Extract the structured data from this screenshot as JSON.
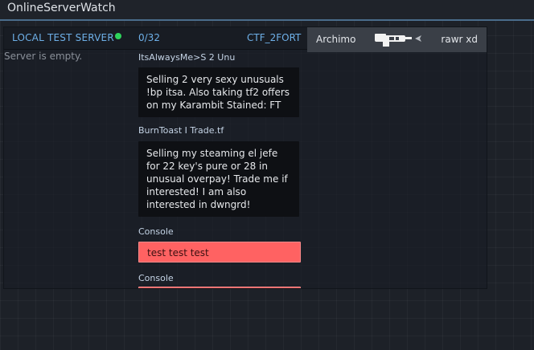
{
  "app": {
    "title": "OnlineServerWatch"
  },
  "server": {
    "name": "LOCAL TEST SERVER",
    "status": "online",
    "status_color": "#2ed35b",
    "players": "0/32",
    "map": "CTF_2FORT",
    "empty_message": "Server is empty."
  },
  "killfeed": {
    "killer": "Archimo",
    "weapon_icon": "shotgun-icon",
    "victim": "rawr xd"
  },
  "chat": [
    {
      "author": "ItsAlwaysMe>S 2 Unu",
      "message": "Selling 2 very sexy unusuals !bp itsa. Also taking tf2 offers on my Karambit Stained: FT"
    },
    {
      "author": "BurnToast I Trade.tf",
      "message": "Selling my steaming el jefe for 22 key's pure or 28 in unusual overpay! Trade me if interested! I am also interested in dwngrd!"
    },
    {
      "author": "Console",
      "message": "test test test"
    },
    {
      "author": "Console",
      "message": ""
    }
  ],
  "colors": {
    "accent": "#6eb0e8",
    "console": "#ff6262",
    "titlebar_border": "#4a6d8c"
  }
}
